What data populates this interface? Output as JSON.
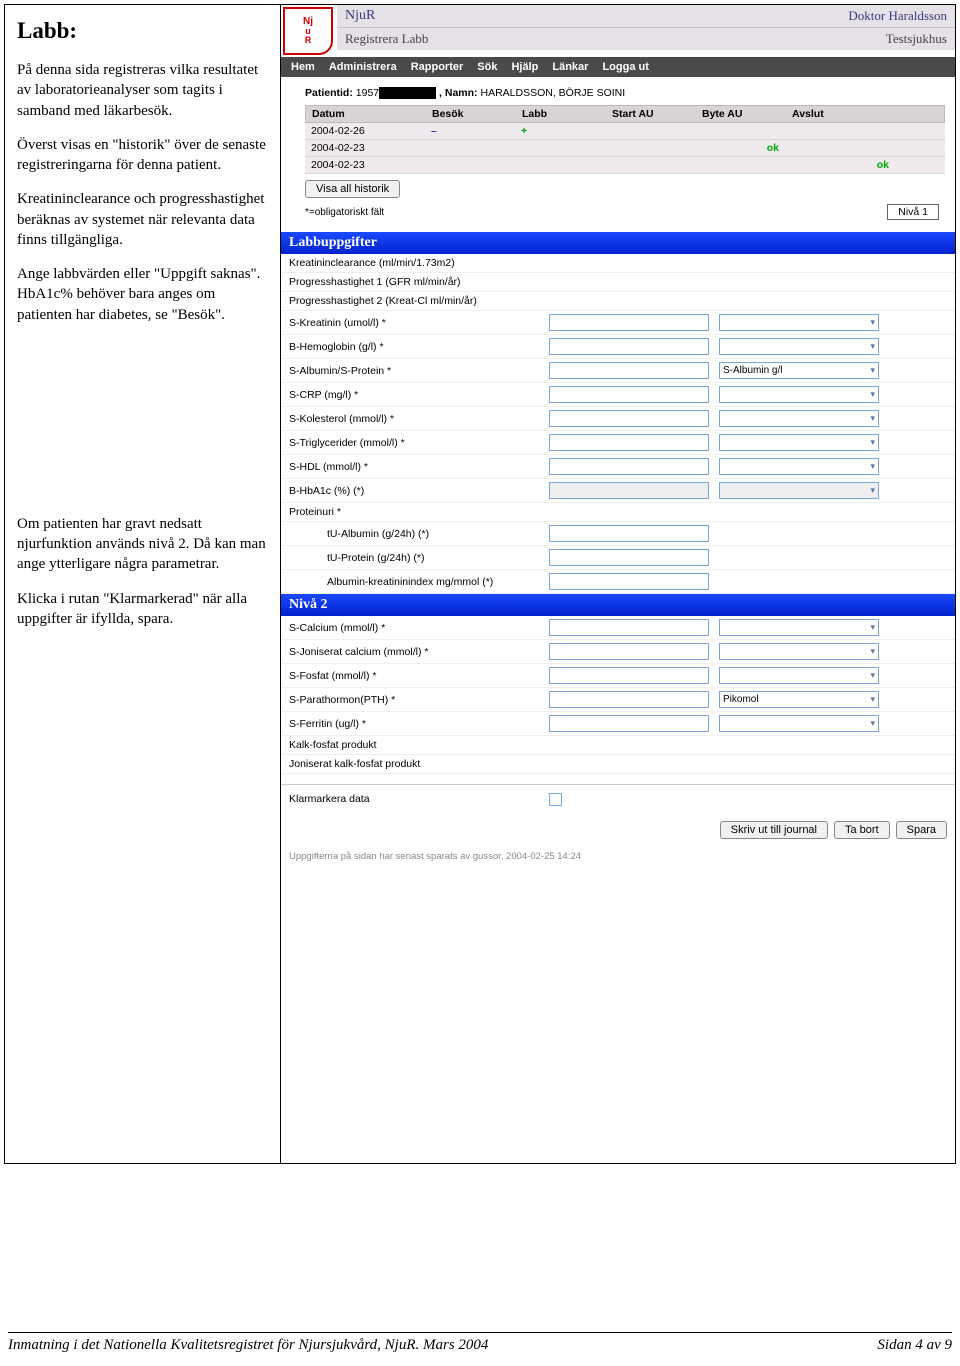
{
  "left": {
    "heading": "Labb:",
    "p1": "På denna sida registreras vilka resultatet av laboratorieanalyser som tagits i samband med läkarbesök.",
    "p2": "Överst visas en \"historik\" över de senaste registreringarna för denna patient.",
    "p3": "Kreatininclearance och progresshastighet beräknas av systemet när relevanta data finns tillgängliga.",
    "p4": "Ange labbvärden eller \"Uppgift saknas\". HbA1c% behöver bara anges om patienten har diabetes, se \"Besök\".",
    "p5": "Om patienten har gravt nedsatt njurfunktion används nivå 2. Då kan man ange ytterligare några parametrar.",
    "p6": "Klicka i rutan \"Klarmarkerad\" när alla uppgifter är ifyllda, spara."
  },
  "app": {
    "title": "NjuR",
    "doctor": "Doktor Haraldsson",
    "subtitle": "Registrera Labb",
    "hospital": "Testsjukhus",
    "menu": [
      "Hem",
      "Administrera",
      "Rapporter",
      "Sök",
      "Hjälp",
      "Länkar",
      "Logga ut"
    ]
  },
  "patient": {
    "idLabel": "Patientid:",
    "idPrefix": "1957",
    "nameLabel": ", Namn:",
    "name": "HARALDSSON, BÖRJE SOINI"
  },
  "history": {
    "headers": [
      "Datum",
      "Besök",
      "Labb",
      "Start AU",
      "Byte AU",
      "Avslut"
    ],
    "rows": [
      {
        "date": "2004-02-26",
        "besok": "–",
        "labb": "+",
        "start": "",
        "byte": "",
        "avslut": ""
      },
      {
        "date": "2004-02-23",
        "besok": "",
        "labb": "",
        "start": "",
        "byte": "ok",
        "avslut": ""
      },
      {
        "date": "2004-02-23",
        "besok": "",
        "labb": "",
        "start": "",
        "byte": "",
        "avslut": "ok"
      }
    ],
    "showAll": "Visa all historik",
    "oblig": "*=obligatoriskt fält",
    "niva": "Nivå 1"
  },
  "sections": {
    "labb": "Labbuppgifter",
    "niva2": "Nivå 2"
  },
  "fields1": [
    {
      "label": "Kreatininclearance (ml/min/1.73m2)",
      "input": false,
      "select": false
    },
    {
      "label": "Progresshastighet 1 (GFR ml/min/år)",
      "input": false,
      "select": false
    },
    {
      "label": "Progresshastighet 2 (Kreat-Cl ml/min/år)",
      "input": false,
      "select": false
    },
    {
      "label": "S-Kreatinin (umol/l) *",
      "input": true,
      "select": true,
      "selText": ""
    },
    {
      "label": "B-Hemoglobin (g/l) *",
      "input": true,
      "select": true,
      "selText": ""
    },
    {
      "label": "S-Albumin/S-Protein *",
      "input": true,
      "select": true,
      "selText": "S-Albumin g/l"
    },
    {
      "label": "S-CRP (mg/l) *",
      "input": true,
      "select": true,
      "selText": ""
    },
    {
      "label": "S-Kolesterol (mmol/l) *",
      "input": true,
      "select": true,
      "selText": ""
    },
    {
      "label": "S-Triglycerider (mmol/l) *",
      "input": true,
      "select": true,
      "selText": ""
    },
    {
      "label": "S-HDL (mmol/l) *",
      "input": true,
      "select": true,
      "selText": ""
    },
    {
      "label": "B-HbA1c (%) (*)",
      "input": true,
      "select": true,
      "selText": "",
      "disabled": true
    },
    {
      "label": "Proteinuri *",
      "input": false,
      "select": false
    },
    {
      "label": "tU-Albumin (g/24h) (*)",
      "input": true,
      "select": false,
      "indent": true
    },
    {
      "label": "tU-Protein (g/24h) (*)",
      "input": true,
      "select": false,
      "indent": true
    },
    {
      "label": "Albumin-kreatininindex mg/mmol (*)",
      "input": true,
      "select": false,
      "indent": true
    }
  ],
  "fields2": [
    {
      "label": "S-Calcium (mmol/l) *",
      "input": true,
      "select": true,
      "selText": ""
    },
    {
      "label": "S-Joniserat calcium (mmol/l) *",
      "input": true,
      "select": true,
      "selText": ""
    },
    {
      "label": "S-Fosfat (mmol/l) *",
      "input": true,
      "select": true,
      "selText": ""
    },
    {
      "label": "S-Parathormon(PTH) *",
      "input": true,
      "select": true,
      "selText": "Pikomol"
    },
    {
      "label": "S-Ferritin (ug/l) *",
      "input": true,
      "select": true,
      "selText": ""
    },
    {
      "label": "Kalk-fosfat produkt",
      "input": false,
      "select": false
    },
    {
      "label": "Joniserat kalk-fosfat produkt",
      "input": false,
      "select": false
    }
  ],
  "klarLabel": "Klarmarkera data",
  "buttons": {
    "print": "Skriv ut till journal",
    "delete": "Ta bort",
    "save": "Spara"
  },
  "savedNote": "Uppgifterna på sidan har senast sparats av gussor, 2004-02-25 14:24",
  "footer": {
    "left": "Inmatning i det Nationella Kvalitetsregistret för Njursjukvård, NjuR.  Mars 2004",
    "right": "Sidan 4 av 9"
  }
}
